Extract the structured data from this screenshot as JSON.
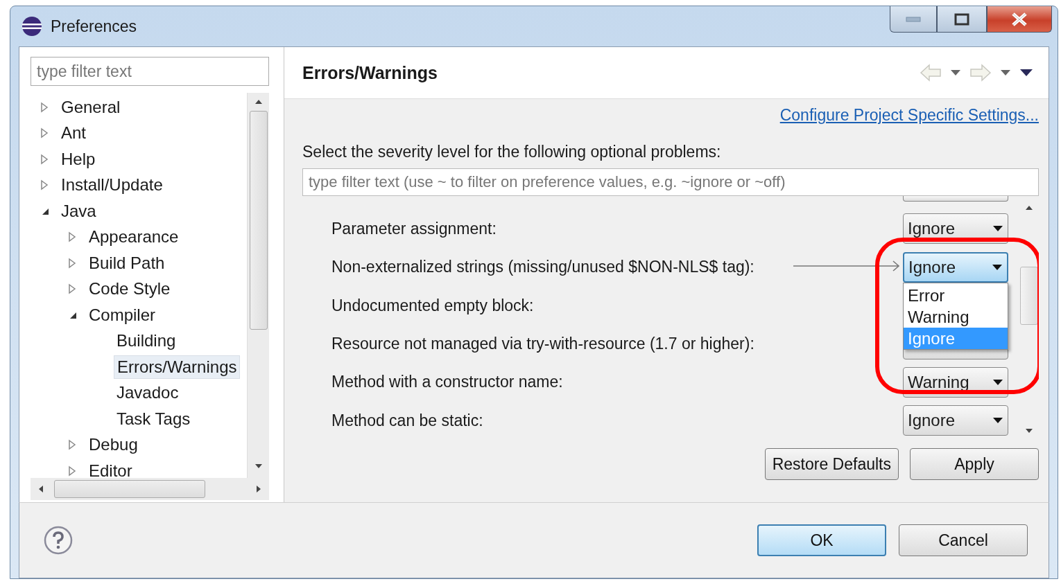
{
  "window": {
    "title": "Preferences"
  },
  "filter": {
    "placeholder": "type filter text"
  },
  "tree": [
    {
      "label": "General",
      "expanded": false,
      "selected": false
    },
    {
      "label": "Ant",
      "expanded": false,
      "selected": false
    },
    {
      "label": "Help",
      "expanded": false,
      "selected": false
    },
    {
      "label": "Install/Update",
      "expanded": false,
      "selected": false
    },
    {
      "label": "Java",
      "expanded": true,
      "selected": false,
      "children": [
        {
          "label": "Appearance",
          "expanded": false,
          "selected": false
        },
        {
          "label": "Build Path",
          "expanded": false,
          "selected": false
        },
        {
          "label": "Code Style",
          "expanded": false,
          "selected": false
        },
        {
          "label": "Compiler",
          "expanded": true,
          "selected": false,
          "children": [
            {
              "label": "Building",
              "selected": false
            },
            {
              "label": "Errors/Warnings",
              "selected": true
            },
            {
              "label": "Javadoc",
              "selected": false
            },
            {
              "label": "Task Tags",
              "selected": false
            }
          ]
        },
        {
          "label": "Debug",
          "expanded": false,
          "selected": false
        },
        {
          "label": "Editor",
          "expanded": false,
          "selected": false
        }
      ]
    }
  ],
  "page": {
    "title": "Errors/Warnings",
    "link": "Configure Project Specific Settings...",
    "intro": "Select the severity level for the following optional problems:",
    "filter_placeholder": "type filter text (use ~ to filter on preference values, e.g. ~ignore or ~off)"
  },
  "options": [
    {
      "label": "Parameter assignment:",
      "value": "Ignore",
      "focused": false
    },
    {
      "label": "Non-externalized strings (missing/unused $NON-NLS$ tag):",
      "value": "Ignore",
      "focused": true
    },
    {
      "label": "Undocumented empty block:",
      "focused": false
    },
    {
      "label": "Resource not managed via try-with-resource (1.7 or higher):",
      "focused": false
    },
    {
      "label": "Method with a constructor name:",
      "value": "Warning",
      "focused": false
    },
    {
      "label": "Method can be static:",
      "value": "Ignore",
      "focused": false
    }
  ],
  "dropdown": [
    {
      "label": "Error",
      "selected": false
    },
    {
      "label": "Warning",
      "selected": false
    },
    {
      "label": "Ignore",
      "selected": true
    }
  ],
  "buttons": {
    "restore": "Restore Defaults",
    "apply": "Apply",
    "ok": "OK",
    "cancel": "Cancel"
  }
}
